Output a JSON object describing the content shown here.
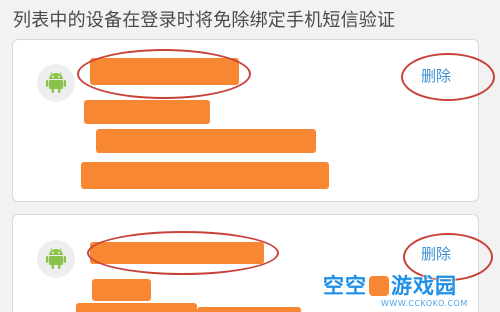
{
  "header": {
    "text": "列表中的设备在登录时将免除绑定手机短信验证"
  },
  "devices": [
    {
      "icon": "android-icon",
      "delete_label": "删除"
    },
    {
      "icon": "android-icon",
      "delete_label": "删除"
    }
  ],
  "colors": {
    "redaction": "#f78733",
    "annotation": "#c8423a",
    "link": "#3b8fd6",
    "android": "#8bc34a"
  },
  "watermark": {
    "text_before": "空空",
    "text_after": "游戏园",
    "url": "WWW.CCKOKO.COM"
  }
}
